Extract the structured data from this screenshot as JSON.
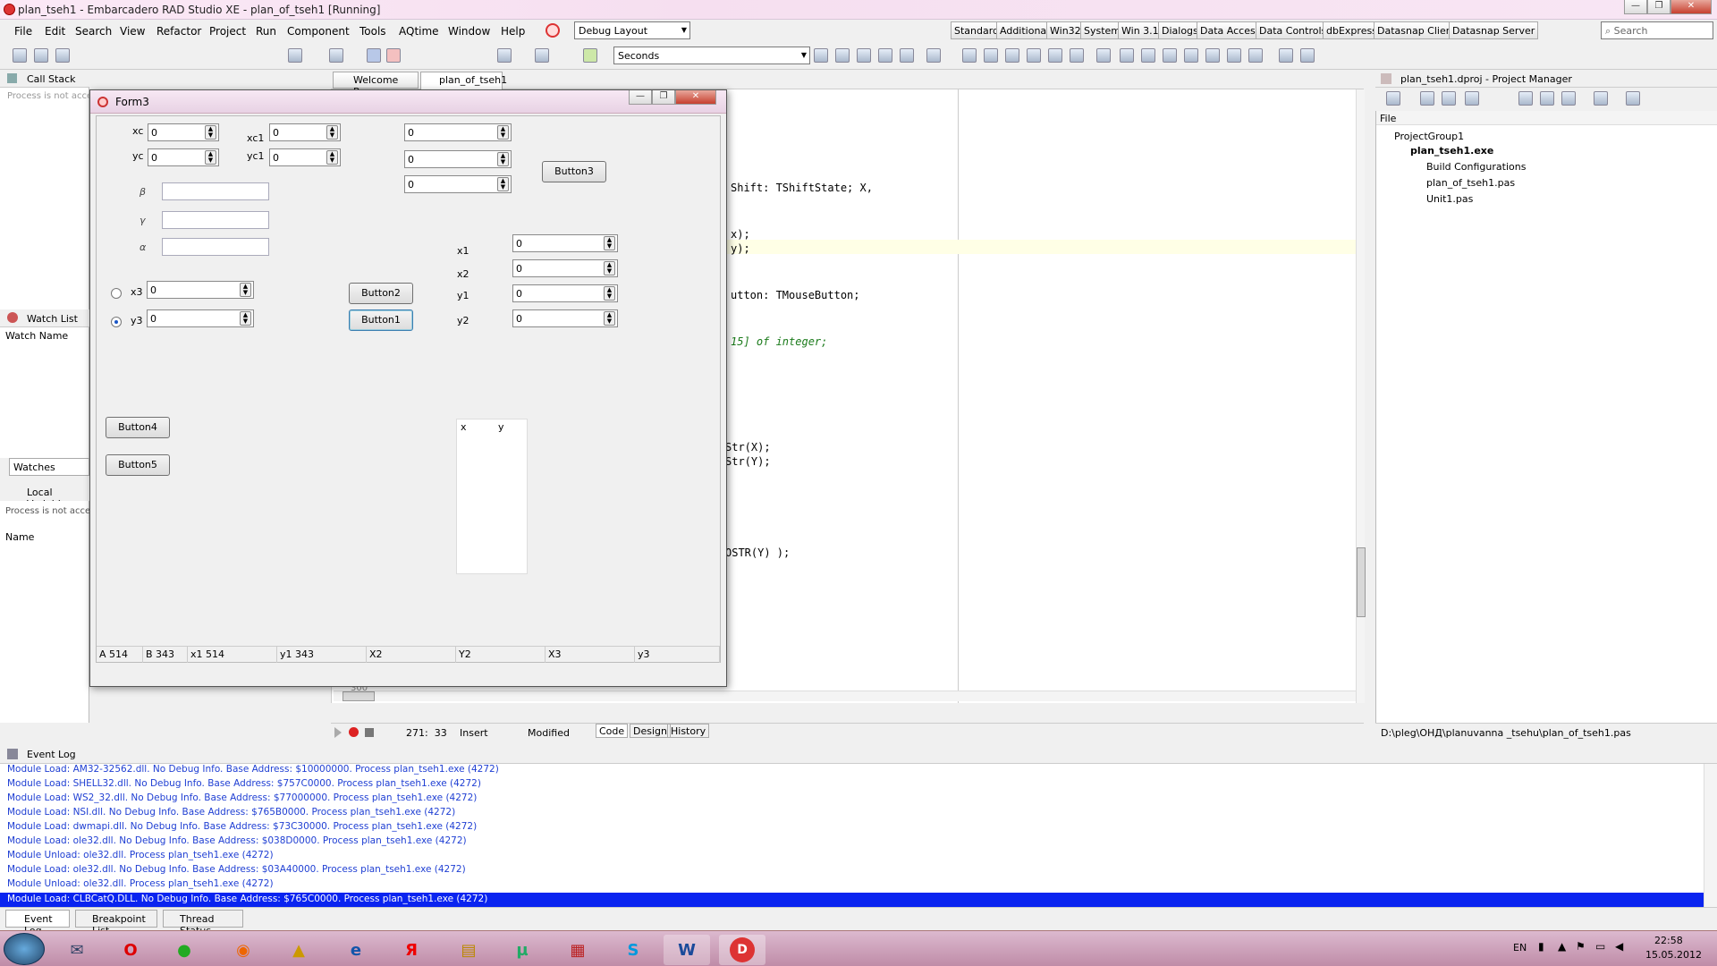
{
  "window": {
    "title": "plan_tseh1 - Embarcadero RAD Studio XE - plan_of_tseh1 [Running]"
  },
  "menu": [
    "File",
    "Edit",
    "Search",
    "View",
    "Refactor",
    "Project",
    "Run",
    "Component",
    "Tools",
    "AQtime",
    "Window",
    "Help"
  ],
  "toolbar": {
    "layout": "Debug Layout",
    "seconds": "Seconds",
    "search_placeholder": "Search"
  },
  "palette_tabs": [
    "Standard",
    "Additional",
    "Win32",
    "System",
    "Win 3.1",
    "Dialogs",
    "Data Access",
    "Data Controls",
    "dbExpress",
    "Datasnap Client",
    "Datasnap Server"
  ],
  "callstack": {
    "title": "Call Stack",
    "status": "Process is not acce"
  },
  "editor_tabs": [
    "Welcome Page",
    "plan_of_tseh1"
  ],
  "watch": {
    "title": "Watch List",
    "col": "Watch Name",
    "tab": "Watches"
  },
  "locals": {
    "title": "Local Variables",
    "status": "Process is not acce",
    "col": "Name"
  },
  "code_lines": [
    "Shift: TShiftState; X,",
    "x);",
    "y);",
    "utton: TMouseButton;",
    "15] of integer;",
    "Str(X);",
    "Str(Y);",
    "OSTR(Y) );"
  ],
  "editor_status": {
    "pos": "271:  33",
    "mode": "Insert",
    "state": "Modified",
    "tabs": [
      "Code",
      "Design",
      "History"
    ]
  },
  "pm": {
    "title": "plan_tseh1.dproj - Project Manager",
    "file": "File",
    "items": [
      "ProjectGroup1",
      "plan_tseh1.exe",
      "Build Configurations",
      "plan_of_tseh1.pas",
      "Unit1.pas"
    ],
    "path": "D:\\pleg\\ОНД\\planuvanna _tsehu\\plan_of_tseh1.pas"
  },
  "form": {
    "title": "Form3",
    "labels": {
      "xc": "xc",
      "yc": "yc",
      "xc1": "xc1",
      "yc1": "yc1",
      "beta": "β",
      "gamma": "γ",
      "alpha": "α",
      "x3": "x3",
      "y3": "y3",
      "x1": "x1",
      "x2": "x2",
      "y1": "y1",
      "y2": "y2"
    },
    "values": {
      "xc": "0",
      "yc": "0",
      "xc1": "0",
      "yc1": "0",
      "r1": "0",
      "r2": "0",
      "r3": "0",
      "x3": "0",
      "y3": "0",
      "x1": "0",
      "x2": "0",
      "y1": "0",
      "y2": "0"
    },
    "buttons": {
      "b1": "Button1",
      "b2": "Button2",
      "b3": "Button3",
      "b4": "Button4",
      "b5": "Button5"
    },
    "grid_headers": [
      "x",
      "y"
    ],
    "status": [
      "A  514",
      "B  343",
      "x1  514",
      "y1  343",
      "X2",
      "Y2",
      "X3",
      "y3"
    ]
  },
  "eventlog": {
    "title": "Event Log",
    "lines": [
      "Module Load: AM32-32562.dll. No Debug Info. Base Address: $10000000. Process plan_tseh1.exe (4272)",
      "Module Load: SHELL32.dll. No Debug Info. Base Address: $757C0000. Process plan_tseh1.exe (4272)",
      "Module Load: WS2_32.dll. No Debug Info. Base Address: $77000000. Process plan_tseh1.exe (4272)",
      "Module Load: NSI.dll. No Debug Info. Base Address: $765B0000. Process plan_tseh1.exe (4272)",
      "Module Load: dwmapi.dll. No Debug Info. Base Address: $73C30000. Process plan_tseh1.exe (4272)",
      "Module Load: ole32.dll. No Debug Info. Base Address: $038D0000. Process plan_tseh1.exe (4272)",
      "Module Unload: ole32.dll. Process plan_tseh1.exe (4272)",
      "Module Load: ole32.dll. No Debug Info. Base Address: $03A40000. Process plan_tseh1.exe (4272)",
      "Module Unload: ole32.dll. Process plan_tseh1.exe (4272)",
      "Module Load: CLBCatQ.DLL. No Debug Info. Base Address: $765C0000. Process plan_tseh1.exe (4272)"
    ],
    "tabs": [
      "Event Log",
      "Breakpoint List",
      "Thread Status"
    ]
  },
  "taskbar": {
    "lang": "EN",
    "time": "22:58",
    "date": "15.05.2012"
  },
  "ruler": "300"
}
